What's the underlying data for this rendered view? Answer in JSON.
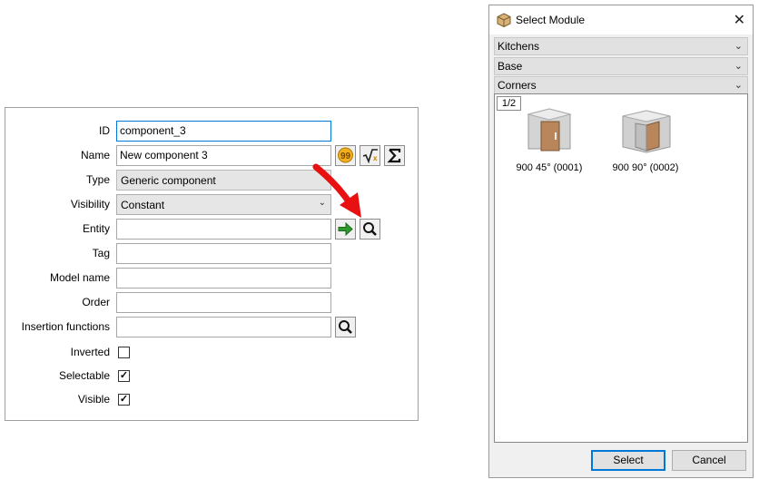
{
  "form": {
    "fields": {
      "id": {
        "label": "ID",
        "value": "component_3"
      },
      "name": {
        "label": "Name",
        "value": "New component 3"
      },
      "type": {
        "label": "Type",
        "value": "Generic component"
      },
      "visibility": {
        "label": "Visibility",
        "value": "Constant"
      },
      "entity": {
        "label": "Entity",
        "value": ""
      },
      "tag": {
        "label": "Tag",
        "value": ""
      },
      "model_name": {
        "label": "Model name",
        "value": ""
      },
      "order": {
        "label": "Order",
        "value": ""
      },
      "insertion_functions": {
        "label": "Insertion functions",
        "value": ""
      },
      "inverted": {
        "label": "Inverted",
        "checked": false
      },
      "selectable": {
        "label": "Selectable",
        "checked": true
      },
      "visible": {
        "label": "Visible",
        "checked": true
      }
    },
    "icons": {
      "translate": "speech-bubble-icon",
      "formula": "square-root-icon",
      "sum": "sigma-icon",
      "go": "green-arrow-icon",
      "search": "magnifier-icon"
    },
    "check_glyph": "✓"
  },
  "dialog": {
    "title": "Select Module",
    "close_glyph": "✕",
    "categories": [
      "Kitchens",
      "Base",
      "Corners"
    ],
    "chevron_glyph": "⌄",
    "page_indicator": "1/2",
    "modules": [
      {
        "caption": "900 45° (0001)"
      },
      {
        "caption": "900 90° (0002)"
      }
    ],
    "buttons": {
      "select": "Select",
      "cancel": "Cancel"
    }
  },
  "annotation": {
    "arrow_color": "#e81010"
  }
}
